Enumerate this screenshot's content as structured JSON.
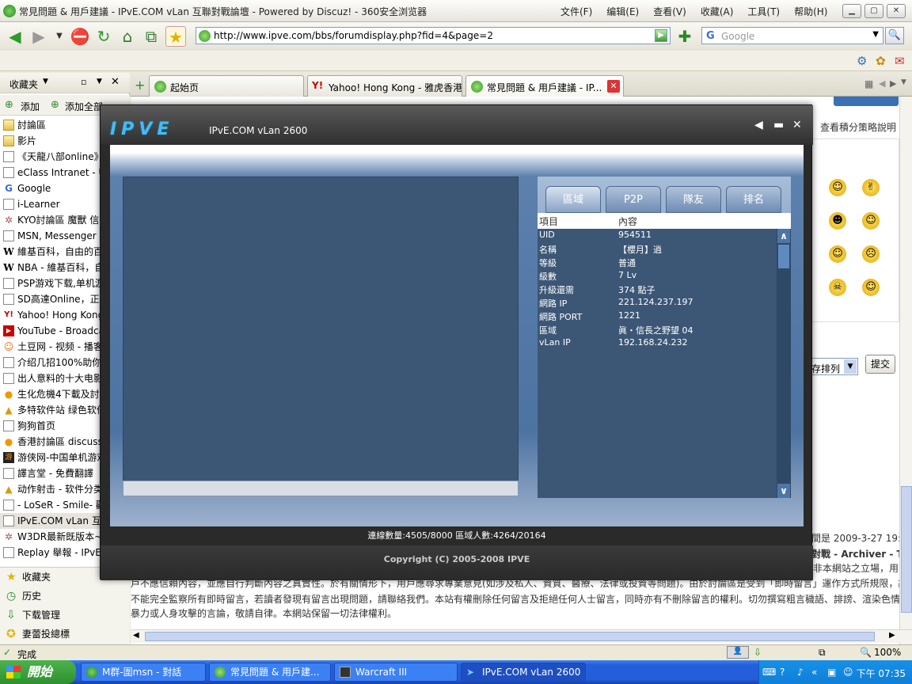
{
  "window": {
    "title": "常見問題 & 用戶建議 - IPvE.COM vLan 互聯對戰論壇 - Powered by Discuz! - 360安全浏览器"
  },
  "menu": [
    "文件(F)",
    "编辑(E)",
    "查看(V)",
    "收藏(A)",
    "工具(T)",
    "帮助(H)"
  ],
  "address": {
    "url": "http://www.ipve.com/bbs/forumdisplay.php?fid=4&page=2"
  },
  "search": {
    "placeholder": "Google"
  },
  "tabs": [
    {
      "label": "起始页"
    },
    {
      "label": "Yahoo! Hong Kong - 雅虎香港"
    },
    {
      "label": "常見問題 & 用戶建議 - IP..."
    }
  ],
  "sidebar": {
    "title": "收藏夹",
    "add_label": "添加",
    "add_all_label": "添加全部",
    "items": [
      {
        "label": "討論區",
        "icon": "folder-icon"
      },
      {
        "label": "影片",
        "icon": "folder-icon"
      },
      {
        "label": "《天龍八部online》",
        "icon": "page-icon"
      },
      {
        "label": "eClass Intranet - Us",
        "icon": "page-icon"
      },
      {
        "label": "Google",
        "icon": "google-icon"
      },
      {
        "label": "i-Learner",
        "icon": "page-icon"
      },
      {
        "label": "KYO討論區 魔獸  信",
        "icon": "kyo-icon"
      },
      {
        "label": "MSN, Messenger ar",
        "icon": "page-icon"
      },
      {
        "label": "維基百科，自由的百",
        "icon": "wikipedia-icon"
      },
      {
        "label": "NBA - 維基百科，自",
        "icon": "wikipedia-icon"
      },
      {
        "label": "PSP游戏下载,单机游",
        "icon": "page-icon"
      },
      {
        "label": "SD高達Online，正統",
        "icon": "page-icon"
      },
      {
        "label": "Yahoo! Hong Kong",
        "icon": "yahoo-icon"
      },
      {
        "label": "YouTube - Broadca",
        "icon": "youtube-icon"
      },
      {
        "label": "土豆网 - 视频 - 播客",
        "icon": "tudou-icon"
      },
      {
        "label": "介绍几招100%助你",
        "icon": "page-icon"
      },
      {
        "label": "出人意料的十大电影",
        "icon": "page-icon"
      },
      {
        "label": "生化危機4下載及討",
        "icon": "chat-icon"
      },
      {
        "label": "多特软件站 绿色软件",
        "icon": "lock-icon"
      },
      {
        "label": "狗狗首页",
        "icon": "page-icon"
      },
      {
        "label": "香港討論區 discuss.",
        "icon": "chat-icon"
      },
      {
        "label": "游侠网-中国单机游戏",
        "icon": "game-icon"
      },
      {
        "label": "譯言堂 - 免費翻譯",
        "icon": "page-icon"
      },
      {
        "label": "动作射击 - 软件分类",
        "icon": "lock-icon"
      },
      {
        "label": "- LoSeR - Smile- 歡",
        "icon": "page-icon"
      },
      {
        "label": "IPvE.COM vLan 互聯",
        "icon": "page-icon"
      },
      {
        "label": "W3DR最新既版本~",
        "icon": "kyo-icon"
      },
      {
        "label": "Replay 舉報 - IPvE.",
        "icon": "page-icon"
      }
    ],
    "bottom": [
      "收藏夹",
      "历史",
      "下载管理",
      "妻蕾投總標"
    ]
  },
  "page_text": {
    "right_link": "查看積分策略說明",
    "sort": "存排列",
    "submit": "提交",
    "time": "間是 2009-3-27 19:3",
    "archiver": "對戰 - Archiver - TO",
    "disclaimer_1": "非本網站之立場，用",
    "disclaimer_2": "戶不應信賴內容，並應自行判斷內容之真實性。於有關情形下，用戶應尋求專業意見(如涉及私人、資質、醫療、法律或投資等問題)。由於討論區是受到「即時留言」運作方式所規限，故",
    "disclaimer_3": "不能完全監察所有即時留言，若讀者發現有留言出現問題，請聯絡我們。本站有權刪除任何留言及拒絕任何人士留言，同時亦有不刪除留言的權利。切勿撰寫粗言穢語、誹謗、渲染色情",
    "disclaimer_4": "暴力或人身攻擊的言論，敬請自律。本網站保留一切法律權利。"
  },
  "popup": {
    "logo": "IPVE",
    "title": "IPvE.COM vLan 2600",
    "tabs": [
      "區域",
      "P2P",
      "隊友",
      "排名"
    ],
    "header": {
      "key": "項目",
      "value": "內容"
    },
    "rows": [
      {
        "k": "UID",
        "v": "954511"
      },
      {
        "k": "名稱",
        "v": "【櫻月】逍"
      },
      {
        "k": "等級",
        "v": "普通"
      },
      {
        "k": "級數",
        "v": "7 Lv"
      },
      {
        "k": "升級還需",
        "v": "374 點子"
      },
      {
        "k": "網路 IP",
        "v": "221.124.237.197"
      },
      {
        "k": "網路 PORT",
        "v": "1221"
      },
      {
        "k": "區域",
        "v": "眞・信長之野望 04"
      },
      {
        "k": "vLan IP",
        "v": "192.168.24.232"
      }
    ],
    "status": "連線數量:4505/8000   區域人數:4264/20164",
    "copyright": "Copyright (C) 2005-2008 IPVE"
  },
  "statusbar": {
    "text": "完成",
    "zoom": "100%"
  },
  "taskbar": {
    "start": "開始",
    "items": [
      "M群-圍msn - 對話",
      "常見問題 & 用戶建...",
      "Warcraft III",
      "IPvE.COM vLan 2600"
    ],
    "clock": "下午 07:35"
  }
}
